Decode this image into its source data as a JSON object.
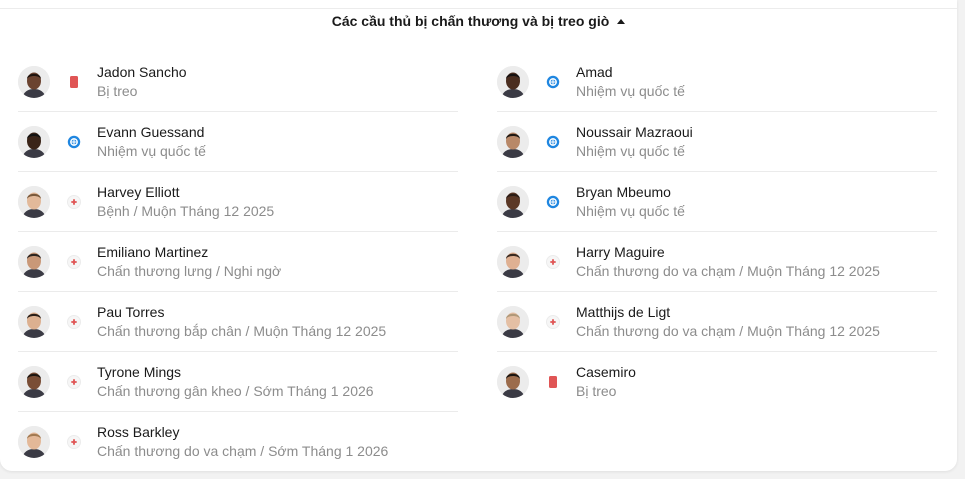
{
  "header": {
    "title": "Các cầu thủ bị chấn thương và bị treo giò"
  },
  "colors": {
    "suspended": "#e05555",
    "international": "#1f86e0",
    "injury": "#e05555"
  },
  "left": [
    {
      "name": "Jadon Sancho",
      "detail": "Bị treo",
      "status": "suspended",
      "skin": "#6b4330",
      "hair": "#1e140f"
    },
    {
      "name": "Evann Guessand",
      "detail": "Nhiệm vụ quốc tế",
      "status": "international",
      "skin": "#3a2418",
      "hair": "#111111"
    },
    {
      "name": "Harvey Elliott",
      "detail": "Bệnh / Muộn Tháng 12 2025",
      "status": "injury",
      "skin": "#e2b99a",
      "hair": "#7a5a3c"
    },
    {
      "name": "Emiliano Martinez",
      "detail": "Chấn thương lưng / Nghi ngờ",
      "status": "injury",
      "skin": "#c99878",
      "hair": "#2d2520"
    },
    {
      "name": "Pau Torres",
      "detail": "Chấn thương bắp chân / Muộn Tháng 12 2025",
      "status": "injury",
      "skin": "#dcb090",
      "hair": "#2a1f18"
    },
    {
      "name": "Tyrone Mings",
      "detail": "Chấn thương gân kheo / Sớm Tháng 1 2026",
      "status": "injury",
      "skin": "#7a4e36",
      "hair": "#1c1510"
    },
    {
      "name": "Ross Barkley",
      "detail": "Chấn thương do va chạm / Sớm Tháng 1 2026",
      "status": "injury",
      "skin": "#e3b898",
      "hair": "#a27a52"
    }
  ],
  "right": [
    {
      "name": "Amad",
      "detail": "Nhiệm vụ quốc tế",
      "status": "international",
      "skin": "#4a2d1f",
      "hair": "#141010"
    },
    {
      "name": "Noussair Mazraoui",
      "detail": "Nhiệm vụ quốc tế",
      "status": "international",
      "skin": "#b88868",
      "hair": "#1f1812"
    },
    {
      "name": "Bryan Mbeumo",
      "detail": "Nhiệm vụ quốc tế",
      "status": "international",
      "skin": "#5b3826",
      "hair": "#2a1c15"
    },
    {
      "name": "Harry Maguire",
      "detail": "Chấn thương do va chạm / Muộn Tháng 12 2025",
      "status": "injury",
      "skin": "#dfb092",
      "hair": "#3a2a20"
    },
    {
      "name": "Matthijs de Ligt",
      "detail": "Chấn thương do va chạm / Muộn Tháng 12 2025",
      "status": "injury",
      "skin": "#e4bfa4",
      "hair": "#b09878"
    },
    {
      "name": "Casemiro",
      "detail": "Bị treo",
      "status": "suspended",
      "skin": "#9c6c4c",
      "hair": "#1a1410"
    }
  ]
}
